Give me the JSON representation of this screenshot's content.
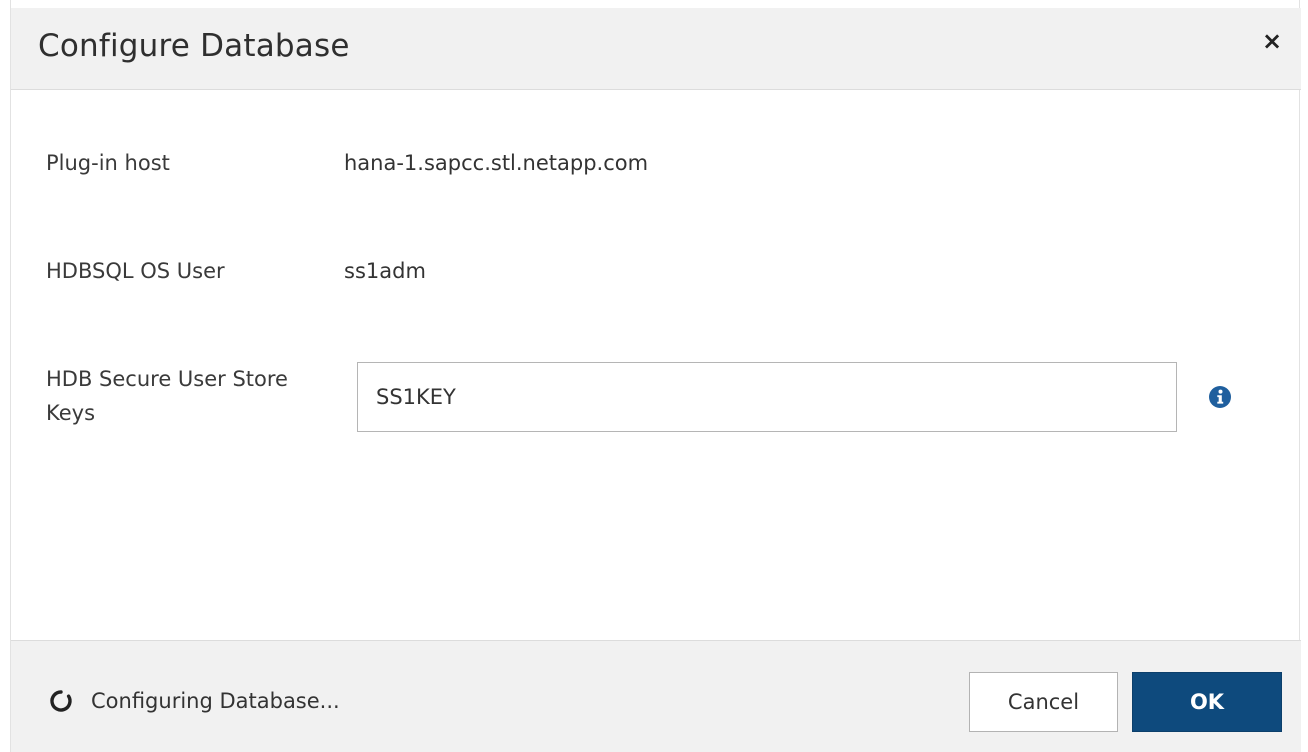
{
  "dialog": {
    "title": "Configure Database",
    "close_label": "×"
  },
  "form": {
    "plugin_host": {
      "label": "Plug-in host",
      "value": "hana-1.sapcc.stl.netapp.com"
    },
    "os_user": {
      "label": "HDBSQL OS User",
      "value": "ss1adm"
    },
    "store_keys": {
      "label_line1": "HDB Secure User Store",
      "label_line2": "Keys",
      "value": "SS1KEY",
      "info_icon": "info-circle-icon"
    }
  },
  "footer": {
    "status": "Configuring Database...",
    "spinner_icon": "loading-spinner-icon",
    "cancel_label": "Cancel",
    "ok_label": "OK"
  },
  "colors": {
    "primary": "#0e4a7d",
    "header_bg": "#f1f1f1",
    "info_icon": "#1f5f9e"
  }
}
